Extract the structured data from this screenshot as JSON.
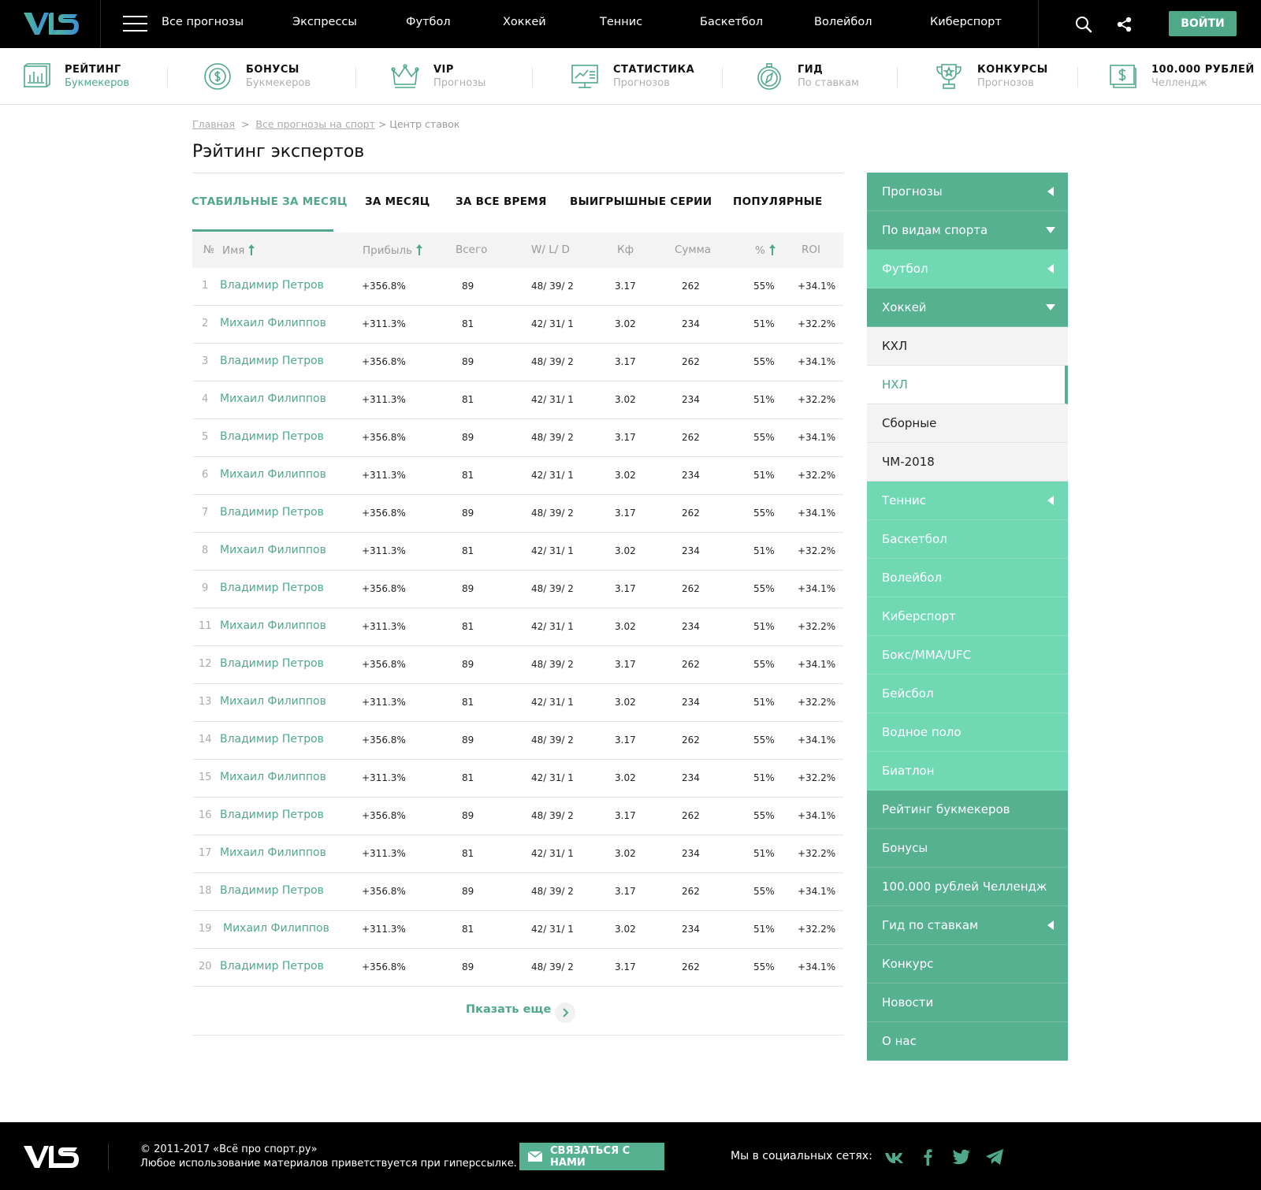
{
  "topnav": {
    "items": [
      "Все прогнозы",
      "Экспрессы",
      "Футбол",
      "Хоккей",
      "Теннис",
      "Баскетбол",
      "Волейбол",
      "Киберспорт"
    ],
    "login": "ВОЙТИ"
  },
  "subnav": [
    {
      "title": "РЕЙТИНГ",
      "sub": "Букмекеров",
      "icon": "rating-chart-icon"
    },
    {
      "title": "БОНУСЫ",
      "sub": "Букмекеров",
      "icon": "bonus-coin-icon"
    },
    {
      "title": "VIP",
      "sub": "Прогнозы",
      "icon": "crown-icon"
    },
    {
      "title": "СТАТИСТИКА",
      "sub": "Прогнозов",
      "icon": "statistics-board-icon"
    },
    {
      "title": "ГИД",
      "sub": "По ставкам",
      "icon": "compass-icon"
    },
    {
      "title": "КОНКУРСЫ",
      "sub": "Прогнозов",
      "icon": "trophy-icon"
    },
    {
      "title": "100.000 РУБЛЕЙ",
      "sub": "Челлендж",
      "icon": "money-icon"
    }
  ],
  "breadcrumb": {
    "home": "Главная",
    "sep1": ">",
    "all": "Все прогнозы на спорт",
    "current": "> Центр ставок"
  },
  "page_title": "Рэйтинг экспертов",
  "tabs": [
    "СТАБИЛЬНЫЕ ЗА МЕСЯЦ",
    "ЗА МЕСЯЦ",
    "ЗА ВСЕ ВРЕМЯ",
    "ВЫИГРЫШНЫЕ СЕРИИ",
    "ПОПУЛЯРНЫЕ"
  ],
  "table": {
    "headers": {
      "num": "№",
      "name": "Имя",
      "profit": "Прибыль",
      "total": "Всего",
      "wld": "W/ L/ D",
      "kf": "Кф",
      "sum": "Сумма",
      "pct": "%",
      "roi": "ROI"
    },
    "rows": [
      {
        "num": "1",
        "name": "Владимир Петров",
        "profit": "+356.8%",
        "total": "89",
        "wld": "48/ 39/ 2",
        "kf": "3.17",
        "sum": "262",
        "pct": "55%",
        "roi": "+34.1%"
      },
      {
        "num": "2",
        "name": "Михаил Филиппов",
        "profit": "+311.3%",
        "total": "81",
        "wld": "42/ 31/ 1",
        "kf": "3.02",
        "sum": "234",
        "pct": "51%",
        "roi": "+32.2%"
      },
      {
        "num": "3",
        "name": "Владимир Петров",
        "profit": "+356.8%",
        "total": "89",
        "wld": "48/ 39/ 2",
        "kf": "3.17",
        "sum": "262",
        "pct": "55%",
        "roi": "+34.1%"
      },
      {
        "num": "4",
        "name": "Михаил Филиппов",
        "profit": "+311.3%",
        "total": "81",
        "wld": "42/ 31/ 1",
        "kf": "3.02",
        "sum": "234",
        "pct": "51%",
        "roi": "+32.2%"
      },
      {
        "num": "5",
        "name": "Владимир Петров",
        "profit": "+356.8%",
        "total": "89",
        "wld": "48/ 39/ 2",
        "kf": "3.17",
        "sum": "262",
        "pct": "55%",
        "roi": "+34.1%"
      },
      {
        "num": "6",
        "name": "Михаил Филиппов",
        "profit": "+311.3%",
        "total": "81",
        "wld": "42/ 31/ 1",
        "kf": "3.02",
        "sum": "234",
        "pct": "51%",
        "roi": "+32.2%"
      },
      {
        "num": "7",
        "name": "Владимир Петров",
        "profit": "+356.8%",
        "total": "89",
        "wld": "48/ 39/ 2",
        "kf": "3.17",
        "sum": "262",
        "pct": "55%",
        "roi": "+34.1%"
      },
      {
        "num": "8",
        "name": "Михаил Филиппов",
        "profit": "+311.3%",
        "total": "81",
        "wld": "42/ 31/ 1",
        "kf": "3.02",
        "sum": "234",
        "pct": "51%",
        "roi": "+32.2%"
      },
      {
        "num": "9",
        "name": "Владимир Петров",
        "profit": "+356.8%",
        "total": "89",
        "wld": "48/ 39/ 2",
        "kf": "3.17",
        "sum": "262",
        "pct": "55%",
        "roi": "+34.1%"
      },
      {
        "num": "11",
        "name": "Михаил Филиппов",
        "profit": "+311.3%",
        "total": "81",
        "wld": "42/ 31/ 1",
        "kf": "3.02",
        "sum": "234",
        "pct": "51%",
        "roi": "+32.2%"
      },
      {
        "num": "12",
        "name": "Владимир Петров",
        "profit": "+356.8%",
        "total": "89",
        "wld": "48/ 39/ 2",
        "kf": "3.17",
        "sum": "262",
        "pct": "55%",
        "roi": "+34.1%"
      },
      {
        "num": "13",
        "name": "Михаил Филиппов",
        "profit": "+311.3%",
        "total": "81",
        "wld": "42/ 31/ 1",
        "kf": "3.02",
        "sum": "234",
        "pct": "51%",
        "roi": "+32.2%"
      },
      {
        "num": "14",
        "name": "Владимир Петров",
        "profit": "+356.8%",
        "total": "89",
        "wld": "48/ 39/ 2",
        "kf": "3.17",
        "sum": "262",
        "pct": "55%",
        "roi": "+34.1%"
      },
      {
        "num": "15",
        "name": "Михаил Филиппов",
        "profit": "+311.3%",
        "total": "81",
        "wld": "42/ 31/ 1",
        "kf": "3.02",
        "sum": "234",
        "pct": "51%",
        "roi": "+32.2%"
      },
      {
        "num": "16",
        "name": "Владимир Петров",
        "profit": "+356.8%",
        "total": "89",
        "wld": "48/ 39/ 2",
        "kf": "3.17",
        "sum": "262",
        "pct": "55%",
        "roi": "+34.1%"
      },
      {
        "num": "17",
        "name": "Михаил Филиппов",
        "profit": "+311.3%",
        "total": "81",
        "wld": "42/ 31/ 1",
        "kf": "3.02",
        "sum": "234",
        "pct": "51%",
        "roi": "+32.2%"
      },
      {
        "num": "18",
        "name": "Владимир Петров",
        "profit": "+356.8%",
        "total": "89",
        "wld": "48/ 39/ 2",
        "kf": "3.17",
        "sum": "262",
        "pct": "55%",
        "roi": "+34.1%"
      },
      {
        "num": "19",
        "name": "Михаил Филиппов",
        "profit": "+311.3%",
        "total": "81",
        "wld": "42/ 31/ 1",
        "kf": "3.02",
        "sum": "234",
        "pct": "51%",
        "roi": "+32.2%"
      },
      {
        "num": "20",
        "name": "Владимир Петров",
        "profit": "+356.8%",
        "total": "89",
        "wld": "48/ 39/ 2",
        "kf": "3.17",
        "sum": "262",
        "pct": "55%",
        "roi": "+34.1%"
      }
    ],
    "show_more": "Пказать еще"
  },
  "sidebar": [
    {
      "label": "Прогнозы",
      "style": "dark",
      "arrow": "left"
    },
    {
      "label": "По видам спорта",
      "style": "dark",
      "arrow": "down"
    },
    {
      "label": "Футбол",
      "style": "light",
      "arrow": "left"
    },
    {
      "label": "Хоккей",
      "style": "dark",
      "arrow": "down"
    },
    {
      "label": "КХЛ",
      "style": "sub",
      "arrow": ""
    },
    {
      "label": "НХЛ",
      "style": "sub active",
      "arrow": ""
    },
    {
      "label": "Сборные",
      "style": "sub",
      "arrow": ""
    },
    {
      "label": "ЧМ-2018",
      "style": "sub",
      "arrow": ""
    },
    {
      "label": "Теннис",
      "style": "light",
      "arrow": "left"
    },
    {
      "label": "Баскетбол",
      "style": "light",
      "arrow": ""
    },
    {
      "label": "Волейбол",
      "style": "light",
      "arrow": ""
    },
    {
      "label": "Киберспорт",
      "style": "light",
      "arrow": ""
    },
    {
      "label": "Бокс/MMA/UFC",
      "style": "light",
      "arrow": ""
    },
    {
      "label": "Бейсбол",
      "style": "light",
      "arrow": ""
    },
    {
      "label": "Водное поло",
      "style": "light",
      "arrow": ""
    },
    {
      "label": "Биатлон",
      "style": "light",
      "arrow": ""
    },
    {
      "label": "Рейтинг букмекеров",
      "style": "dark",
      "arrow": ""
    },
    {
      "label": "Бонусы",
      "style": "dark",
      "arrow": ""
    },
    {
      "label": "100.000 рублей Челлендж",
      "style": "dark",
      "arrow": ""
    },
    {
      "label": "Гид по ставкам",
      "style": "dark",
      "arrow": "left"
    },
    {
      "label": "Конкурс",
      "style": "dark",
      "arrow": ""
    },
    {
      "label": "Новости",
      "style": "dark",
      "arrow": ""
    },
    {
      "label": "О нас",
      "style": "dark",
      "arrow": ""
    }
  ],
  "footer": {
    "copy1": "© 2011-2017 «Всё про спорт.ру»",
    "copy2": "Любое использование материалов приветствуется при гиперссылке.",
    "contact": "СВЯЗАТЬСЯ С НАМИ",
    "social_label": "Мы в социальных сетях:",
    "socials": [
      "vk-icon",
      "facebook-icon",
      "twitter-icon",
      "telegram-icon"
    ]
  },
  "colors": {
    "accent": "#4fa989",
    "sidebar_dark": "#56b190",
    "sidebar_light": "#70d8b3"
  }
}
